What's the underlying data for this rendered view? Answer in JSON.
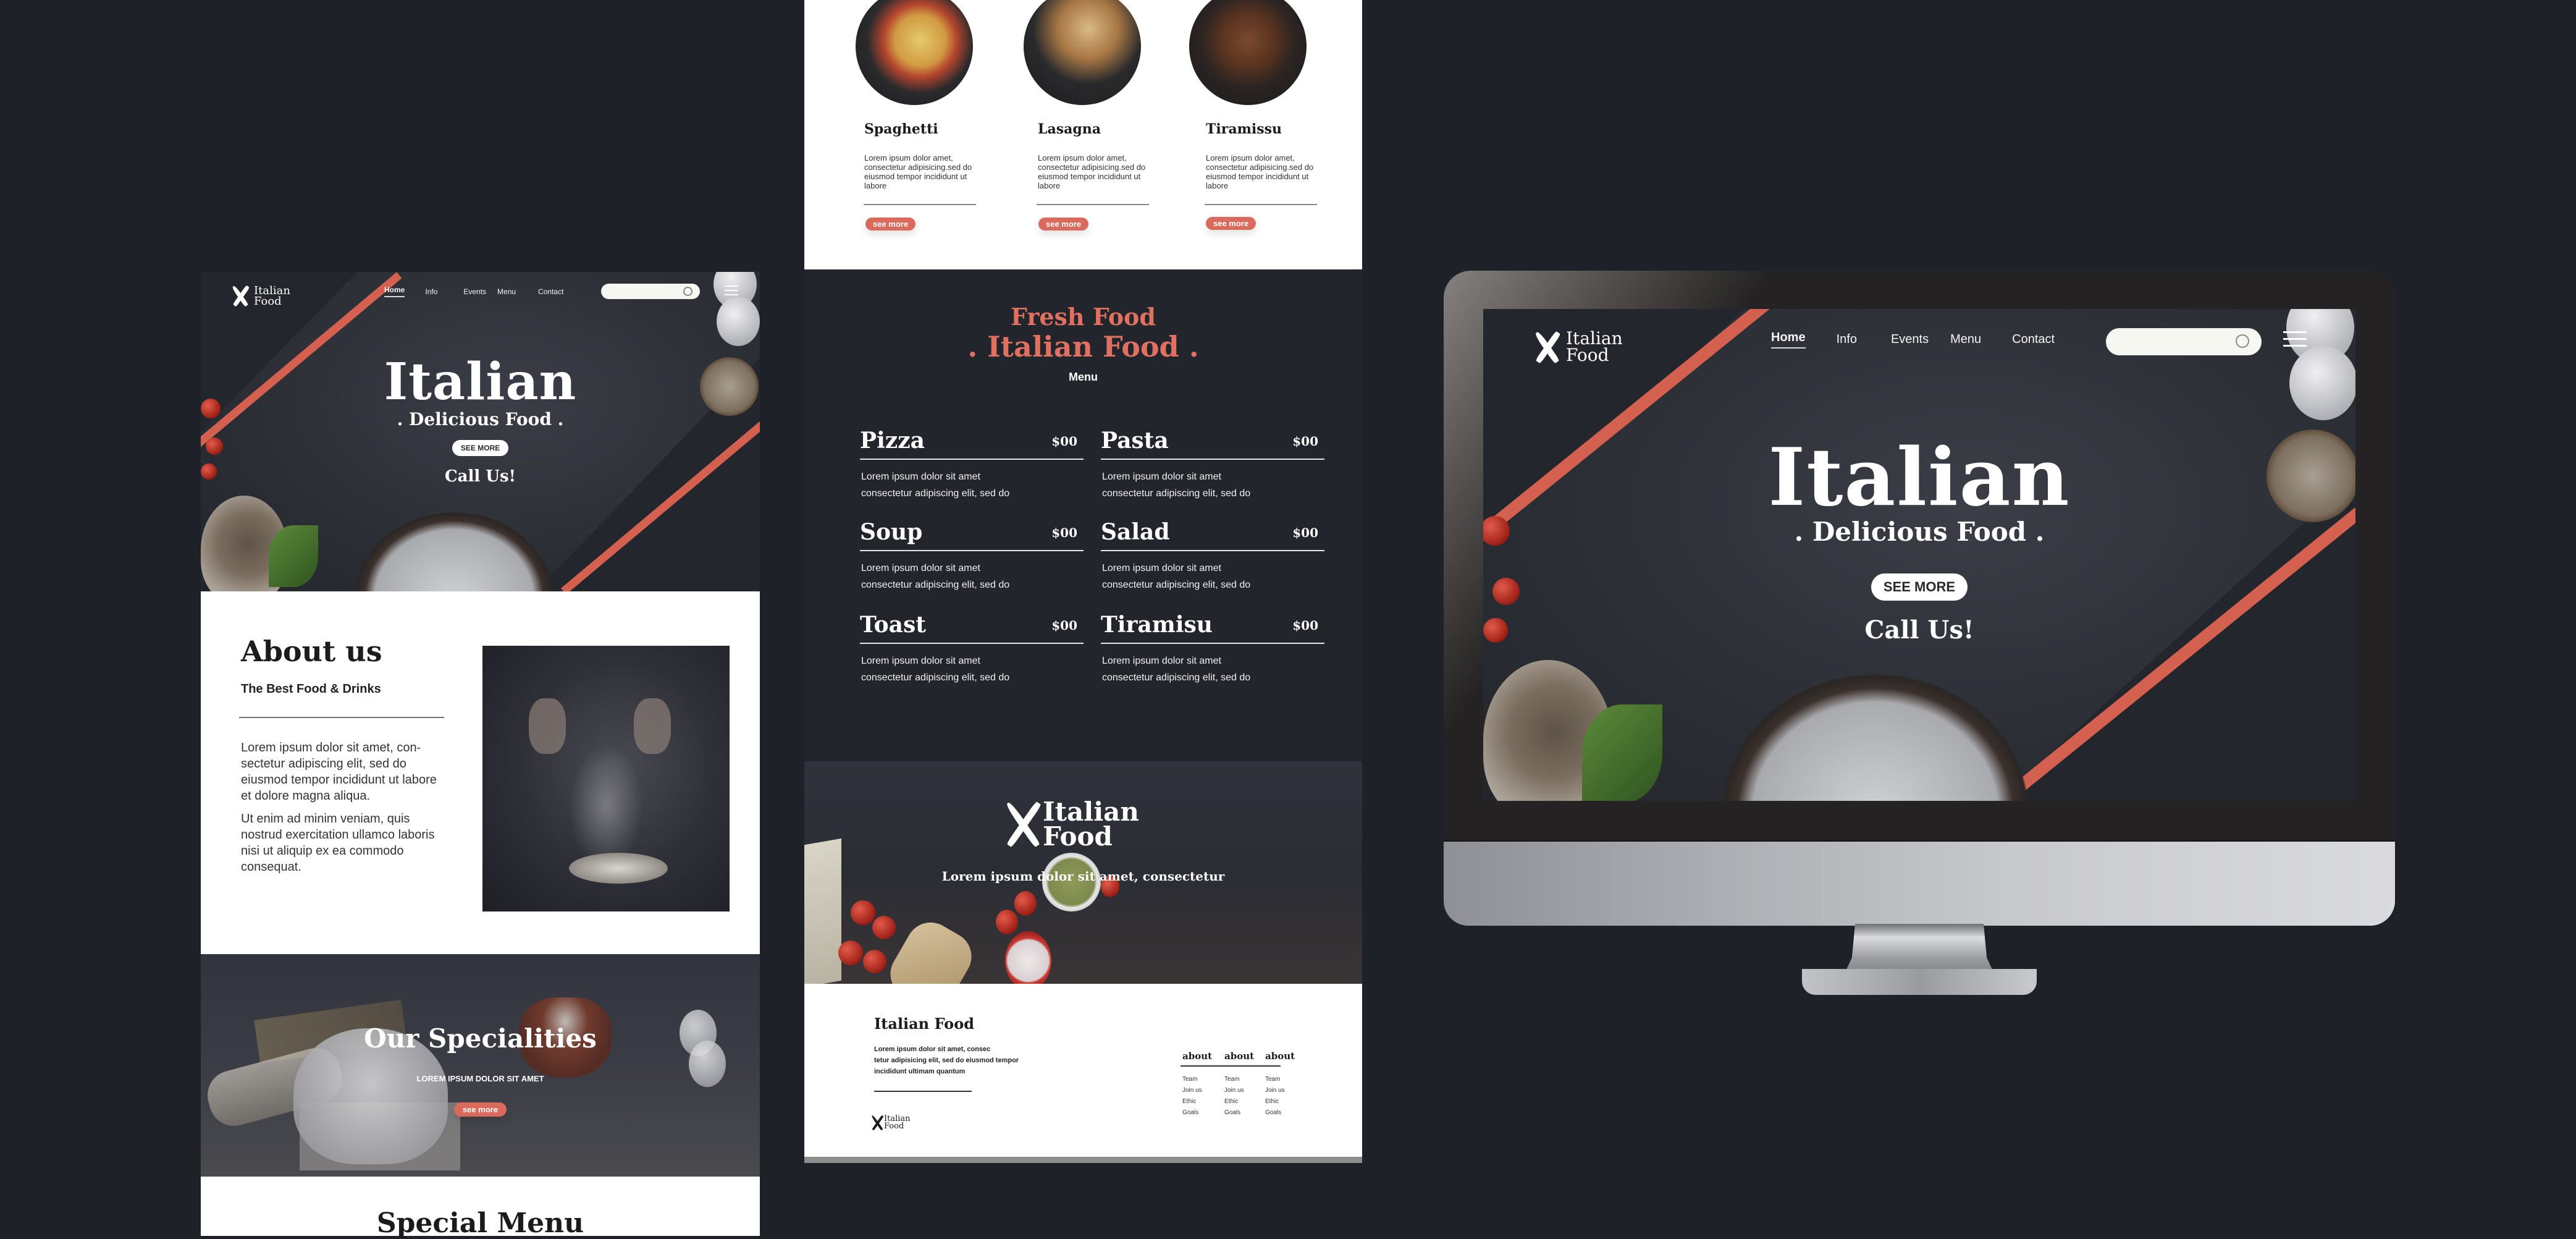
{
  "brand": {
    "logo_line1": "Italian",
    "logo_line2": "Food",
    "accent_color": "#d96a5c",
    "background_color": "#1f2129"
  },
  "nav": {
    "items": [
      {
        "label": "Home",
        "active": true
      },
      {
        "label": "Info",
        "active": false
      },
      {
        "label": "Events",
        "active": false
      },
      {
        "label": "Menu",
        "active": false
      },
      {
        "label": "Contact",
        "active": false
      }
    ],
    "search_placeholder": "",
    "search_icon": "search-icon",
    "menu_icon": "hamburger-menu-icon"
  },
  "hero": {
    "title": "Italian",
    "subtitle": ". Delicious Food .",
    "cta_label": "SEE MORE",
    "call_text": "Call Us!"
  },
  "about": {
    "title": "About us",
    "subtitle": "The Best Food & Drinks",
    "paragraph1": "Lorem ipsum dolor sit amet, con-sectetur adipiscing elit, sed do eiusmod tempor incididunt ut labore et dolore magna aliqua.",
    "paragraph2": "Ut enim ad minim veniam, quis nostrud exercitation ullamco laboris nisi ut aliquip ex ea commodo consequat."
  },
  "specialities": {
    "title": "Our Specialities",
    "subtitle": "LOREM IPSUM DOLOR SIT AMET",
    "button_label": "see more"
  },
  "special_menu": {
    "title": "Special Menu"
  },
  "dishes": [
    {
      "name": "Spaghetti",
      "description": "Lorem ipsum dolor amet, consectetur adipisicing.sed do eiusmod tempor incididunt ut labore",
      "button_label": "see more"
    },
    {
      "name": "Lasagna",
      "description": "Lorem ipsum dolor amet, consectetur adipisicing.sed do eiusmod tempor incididunt ut labore",
      "button_label": "see more"
    },
    {
      "name": "Tiramissu",
      "description": "Lorem ipsum dolor amet, consectetur adipisicing.sed do eiusmod tempor incididunt ut labore",
      "button_label": "see more"
    }
  ],
  "menu_section": {
    "heading1": "Fresh Food",
    "heading2": ". Italian Food .",
    "label": "Menu",
    "items": [
      {
        "name": "Pizza",
        "price": "$00",
        "desc_line1": "Lorem ipsum dolor sit amet",
        "desc_line2": "consectetur adipiscing elit, sed do"
      },
      {
        "name": "Pasta",
        "price": "$00",
        "desc_line1": "Lorem ipsum dolor sit amet",
        "desc_line2": "consectetur adipiscing elit, sed do"
      },
      {
        "name": "Soup",
        "price": "$00",
        "desc_line1": "Lorem ipsum dolor sit amet",
        "desc_line2": "consectetur adipiscing elit, sed do"
      },
      {
        "name": "Salad",
        "price": "$00",
        "desc_line1": "Lorem ipsum dolor sit amet",
        "desc_line2": "consectetur adipiscing elit, sed do"
      },
      {
        "name": "Toast",
        "price": "$00",
        "desc_line1": "Lorem ipsum dolor sit amet",
        "desc_line2": "consectetur adipiscing elit, sed do"
      },
      {
        "name": "Tiramisu",
        "price": "$00",
        "desc_line1": "Lorem ipsum dolor sit amet",
        "desc_line2": "consectetur adipiscing elit, sed do"
      }
    ]
  },
  "banner": {
    "tagline": "Lorem ipsum dolor sit amet, consectetur"
  },
  "footer": {
    "title": "Italian Food",
    "text_line1": "Lorem ipsum dolor sit amet, consec",
    "text_line2": "tetur adipisicing elit, sed do eiusmod tempor",
    "text_line3": "incididunt ultimam quantum",
    "columns": [
      {
        "heading": "about",
        "links": [
          "Team",
          "Join us",
          "Ethic",
          "Goals"
        ]
      },
      {
        "heading": "about",
        "links": [
          "Team",
          "Join us",
          "Ethic",
          "Goals"
        ]
      },
      {
        "heading": "about",
        "links": [
          "Team",
          "Join us",
          "Ethic",
          "Goals"
        ]
      }
    ]
  }
}
